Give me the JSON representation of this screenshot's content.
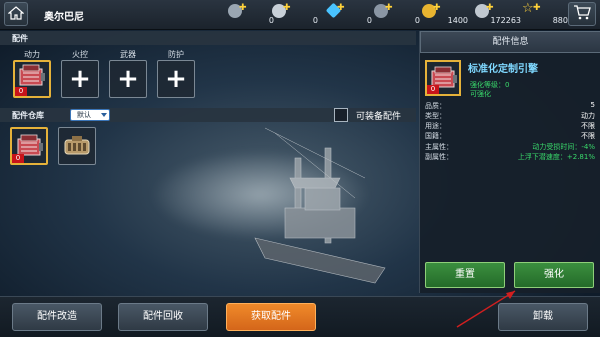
{
  "topbar": {
    "player_name": "奥尔巴尼",
    "resources": [
      {
        "name": "resource-a",
        "value": "0",
        "color": "#9aa6b2"
      },
      {
        "name": "resource-b",
        "value": "0",
        "color": "#c8d0d8"
      },
      {
        "name": "diamond",
        "value": "0",
        "color": "#49c3ff"
      },
      {
        "name": "resource-d",
        "value": "0",
        "color": "#8a96a4"
      },
      {
        "name": "gold-coin",
        "value": "1400",
        "color": "#e8b430"
      },
      {
        "name": "silver-coin",
        "value": "172263",
        "color": "#c0c8d0"
      },
      {
        "name": "star",
        "value": "880",
        "color": "#ffd23a"
      }
    ]
  },
  "parts": {
    "header": "配件",
    "slots": [
      {
        "label": "动力",
        "count": "0",
        "filled": true
      },
      {
        "label": "火控",
        "filled": false
      },
      {
        "label": "武器",
        "filled": false
      },
      {
        "label": "防护",
        "filled": false
      }
    ]
  },
  "warehouse": {
    "header": "配件仓库",
    "sort_value": "默认",
    "equippable_label": "可装备配件",
    "items": [
      {
        "type": "engine",
        "count": "0"
      },
      {
        "type": "mechanical"
      }
    ]
  },
  "info": {
    "title": "配件信息",
    "part_name": "标准化定制引擎",
    "enhance_level": "强化等级：0",
    "enhance_status": "可强化",
    "count": "0",
    "stats": [
      {
        "key": "品质：",
        "value": "5",
        "style": "white"
      },
      {
        "key": "类型：",
        "value": "动力",
        "style": "white"
      },
      {
        "key": "用途：",
        "value": "不限",
        "style": "white"
      },
      {
        "key": "国籍：",
        "value": "不限",
        "style": "white"
      },
      {
        "key": "主属性：",
        "value": "动力受损时间：-4%",
        "style": "green"
      },
      {
        "key": "副属性：",
        "value": "上浮下潜速度：+2.81%",
        "style": "green"
      }
    ],
    "reset_label": "重置",
    "enhance_label": "强化"
  },
  "bottom": {
    "modify_label": "配件改造",
    "recycle_label": "配件回收",
    "get_label": "获取配件",
    "unload_label": "卸载"
  },
  "colors": {
    "accent_orange": "#e5782a",
    "accent_green": "#2f7d34",
    "stat_green": "#39d96b",
    "part_name_blue": "#7fd8ff"
  }
}
